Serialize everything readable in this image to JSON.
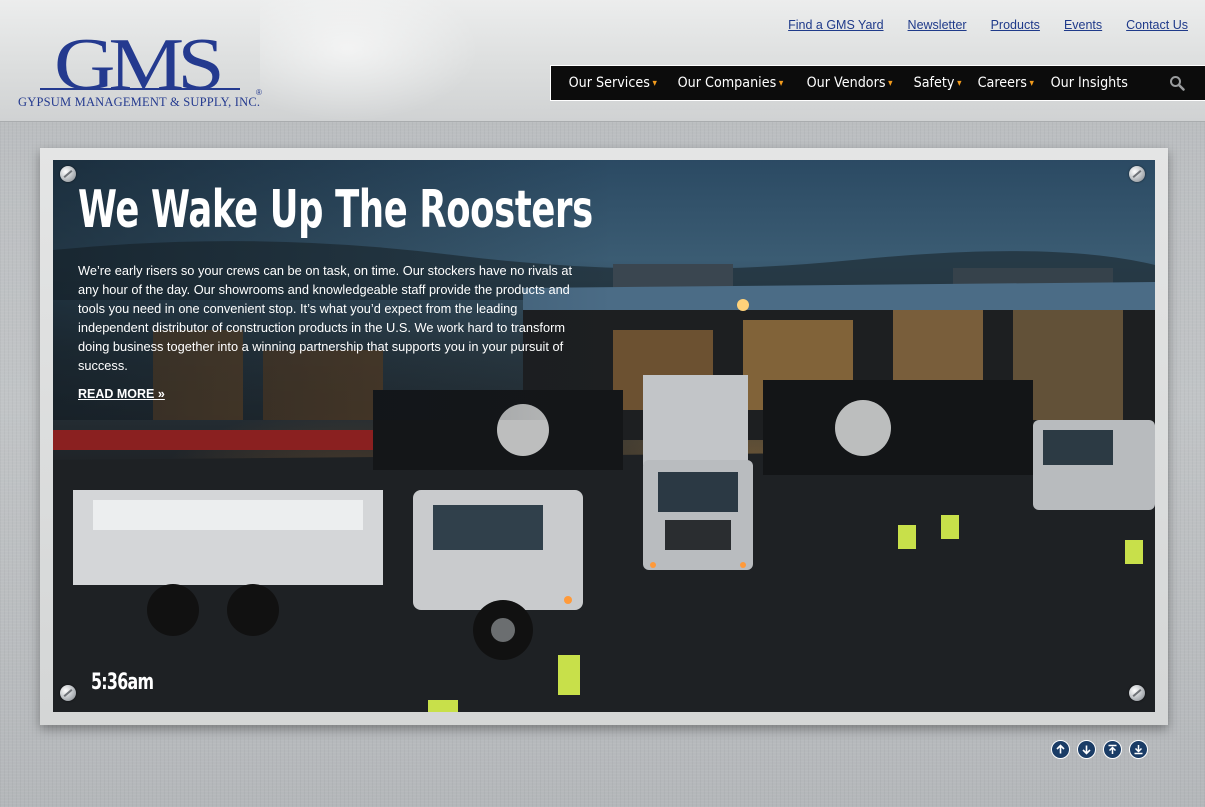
{
  "brand": {
    "logo_text": "GMS",
    "logo_subtitle": "GYPSUM MANAGEMENT & SUPPLY, INC.",
    "registered_mark": "®",
    "color": "#243a8f"
  },
  "top_links": [
    {
      "label": "Find a GMS Yard"
    },
    {
      "label": "Newsletter"
    },
    {
      "label": "Products"
    },
    {
      "label": "Events"
    },
    {
      "label": "Contact Us"
    }
  ],
  "nav": {
    "items": [
      {
        "label": "Our Services",
        "has_dropdown": true
      },
      {
        "label": "Our Companies",
        "has_dropdown": true
      },
      {
        "label": "Our Vendors",
        "has_dropdown": true
      },
      {
        "label": "Safety",
        "has_dropdown": true
      },
      {
        "label": "Careers",
        "has_dropdown": true
      },
      {
        "label": "Our Insights",
        "has_dropdown": false
      }
    ],
    "dropdown_arrow": "▾",
    "arrow_color": "#f29b1d",
    "search_icon": "search-icon"
  },
  "hero": {
    "title": "We Wake Up The Roosters",
    "body": "We’re early risers so your crews can be on task, on time. Our stockers have no rivals at any hour of the day. Our showrooms and knowledgeable staff provide the products and tools you need in one convenient stop. It’s what you’d expect from the leading independent distributor of construction products in the U.S. We work hard to transform doing business together into a winning partnership that supports you in your pursuit of success.",
    "read_more": "READ MORE »",
    "time": "5:36am"
  },
  "controls": [
    {
      "icon": "arrow-up-icon"
    },
    {
      "icon": "arrow-down-icon"
    },
    {
      "icon": "arrow-to-top-icon"
    },
    {
      "icon": "arrow-to-bottom-icon"
    }
  ]
}
